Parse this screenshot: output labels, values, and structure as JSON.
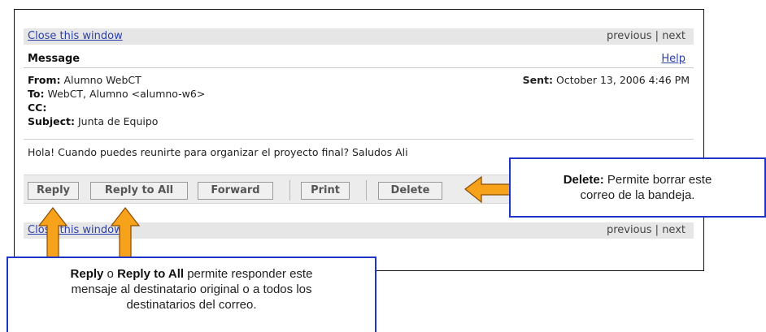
{
  "window": {
    "close_link": "Close this window",
    "nav": "previous | next",
    "bottom_close_link": "Close this window",
    "bottom_nav": "previous | next"
  },
  "message": {
    "title": "Message",
    "help": "Help",
    "from_label": "From:",
    "from_value": "Alumno WebCT",
    "to_label": "To:",
    "to_value": "WebCT, Alumno <alumno-w6>",
    "cc_label": "CC:",
    "cc_value": "",
    "subject_label": "Subject:",
    "subject_value": "Junta de Equipo",
    "sent_label": "Sent:",
    "sent_value": "October 13, 2006 4:46 PM",
    "body": "Hola! Cuando puedes reunirte para organizar el proyecto final? Saludos Ali"
  },
  "buttons": {
    "reply": "Reply",
    "reply_all": "Reply to All",
    "forward": "Forward",
    "print": "Print",
    "delete": "Delete"
  },
  "callouts": {
    "delete_bold": "Delete:",
    "delete_text1": " Permite borrar este",
    "delete_text2": "correo de la bandeja.",
    "reply_bold1": "Reply",
    "reply_o": " o ",
    "reply_bold2": "Reply to All",
    "reply_text1": " permite  responder este",
    "reply_text2": "mensaje al destinatario original  o a todos los",
    "reply_text3": "destinatarios del correo."
  },
  "colors": {
    "accent_arrow": "#f7a21b",
    "callout_border": "#1f35c8",
    "link": "#2b3fa8"
  }
}
